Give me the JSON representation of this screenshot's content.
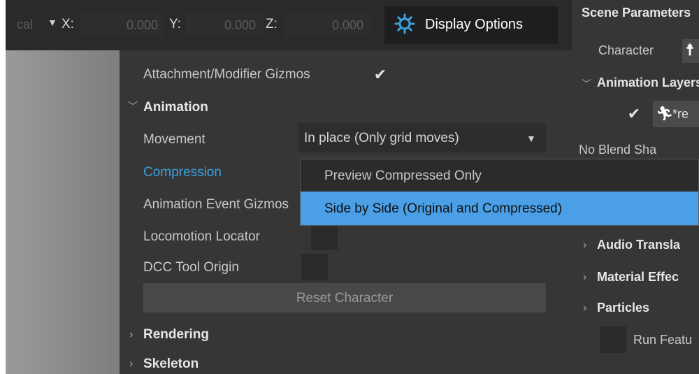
{
  "toolbar": {
    "coord_mode": "cal",
    "x_label": "X:",
    "x_value": "0.000",
    "y_label": "Y:",
    "y_value": "0.000",
    "z_label": "Z:",
    "z_value": "0.000",
    "display_options": "Display Options"
  },
  "gizmos": {
    "attachment_label": "Attachment/Modifier Gizmos",
    "animation_header": "Animation",
    "movement_label": "Movement",
    "movement_value": "In place (Only grid moves)",
    "compression_label": "Compression",
    "event_label": "Animation Event Gizmos",
    "locomotion_label": "Locomotion Locator",
    "dcc_label": "DCC Tool Origin",
    "reset_button": "Reset Character",
    "rendering_header": "Rendering",
    "skeleton_header": "Skeleton"
  },
  "dropdown": {
    "options": [
      "Preview Compressed Only",
      "Side by Side (Original and Compressed)"
    ],
    "highlighted_index": 1
  },
  "scene": {
    "title": "Scene Parameters",
    "character_label": "Character",
    "animation_layers": "Animation Layers",
    "layer_name": "*re",
    "no_blend_shapes": "No Blend Sha",
    "audio": "Audio Transla",
    "material": "Material Effec",
    "particles": "Particles",
    "run_feature": "Run Featu"
  },
  "colors": {
    "panel_bg": "#363636",
    "field_bg": "#2d2d2d",
    "accent_blue": "#3aa0e0",
    "highlight": "#4a9fe6"
  }
}
